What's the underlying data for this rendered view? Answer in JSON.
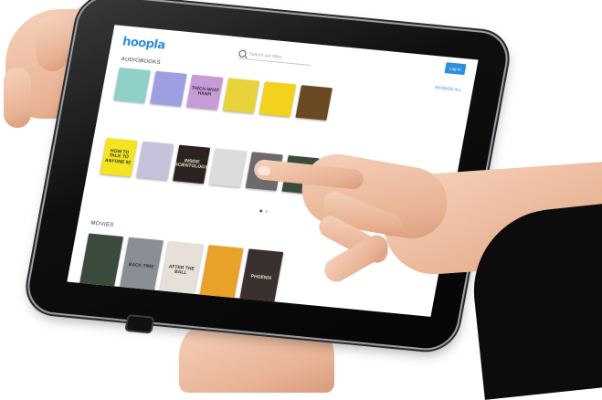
{
  "app": {
    "logo_text": "hoopla",
    "login_label": "Log In",
    "browse_all_label": "BROWSE ALL",
    "search": {
      "placeholder": "Search our titles"
    },
    "colors": {
      "brand": "#2f8fdc"
    }
  },
  "sections": {
    "audiobooks": {
      "label": "AUDIOBOOKS",
      "row1": [
        {
          "text": "",
          "bg": "#8fd0c9"
        },
        {
          "text": "",
          "bg": "#9e9fe0"
        },
        {
          "text": "THICH NHAT HANH",
          "bg": "#c79ad8"
        },
        {
          "text": "",
          "bg": "#e9d33a"
        },
        {
          "text": "",
          "bg": "#f2d21c"
        },
        {
          "text": "",
          "bg": "#6a4a22"
        }
      ],
      "row2": [
        {
          "text": "HOW TO TALK TO ANYONE 92",
          "bg": "#f3e321"
        },
        {
          "text": "",
          "bg": "#c8c1dc"
        },
        {
          "text": "INSIDE SCIENTOLOGY",
          "bg": "#2a2320"
        },
        {
          "text": "",
          "bg": "#dcdcdc"
        },
        {
          "text": "",
          "bg": "#6c6a6a"
        },
        {
          "text": "",
          "bg": "#3b4b3a"
        }
      ],
      "pager": {
        "total": 2,
        "active": 1
      }
    },
    "movies": {
      "label": "MOVIES",
      "row": [
        {
          "text": "",
          "bg": "#3a4a3c"
        },
        {
          "text": "BACK TIME",
          "bg": "#8a8f96"
        },
        {
          "text": "AFTER THE BALL",
          "bg": "#e6e0d8"
        },
        {
          "text": "",
          "bg": "#e8a22a"
        },
        {
          "text": "PHOENIX",
          "bg": "#3a3030"
        }
      ]
    }
  }
}
